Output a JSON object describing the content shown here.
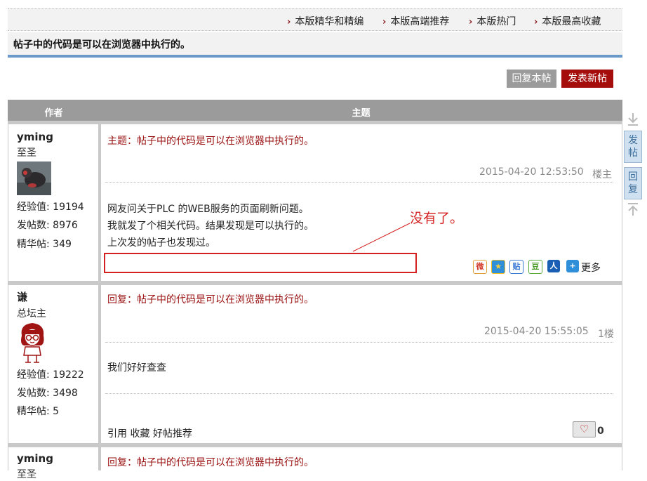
{
  "nav": {
    "links": [
      "本版精华和精编",
      "本版高端推荐",
      "本版热门",
      "本版最高收藏"
    ],
    "arrow": "›"
  },
  "thread": {
    "title": "帖子中的代码是可以在浏览器中执行的。"
  },
  "actions": {
    "reply": "回复本帖",
    "new_post": "发表新帖"
  },
  "table": {
    "col_author": "作者",
    "col_subject": "主题"
  },
  "posts": [
    {
      "author": "yming",
      "rank": "至圣",
      "exp": "经验值: 19194",
      "posts": "发帖数: 8976",
      "digest": "精华帖: 349",
      "subject": "主题：帖子中的代码是可以在浏览器中执行的。",
      "time": "2015-04-20 12:53:50",
      "floor": "楼主",
      "lines": [
        "网友问关于PLC 的WEB服务的页面刷新问题。",
        "我就发了个相关代码。结果发现是可以执行的。",
        "上次发的帖子也发现过。"
      ],
      "share_more": "更多"
    },
    {
      "author": "谦",
      "rank": "总坛主",
      "exp": "经验值: 19222",
      "posts": "发帖数: 3498",
      "digest": "精华帖: 5",
      "subject": "回复：帖子中的代码是可以在浏览器中执行的。",
      "time": "2015-04-20 15:55:05",
      "floor": "1楼",
      "lines": [
        "我们好好查查"
      ],
      "footer": "引用 收藏 好帖推荐",
      "likes": "0"
    },
    {
      "author": "yming",
      "rank": "至圣",
      "subject": "回复：帖子中的代码是可以在浏览器中执行的。"
    }
  ],
  "annotation": {
    "text": "没有了。",
    "color": "#d42020"
  },
  "float": {
    "post": "发帖",
    "reply": "回复"
  },
  "colors": {
    "accent": "#9a1010",
    "btn_gray": "#9b9b9b",
    "btn_red": "#a50d0d",
    "bar_blue": "#6a9ac9"
  }
}
